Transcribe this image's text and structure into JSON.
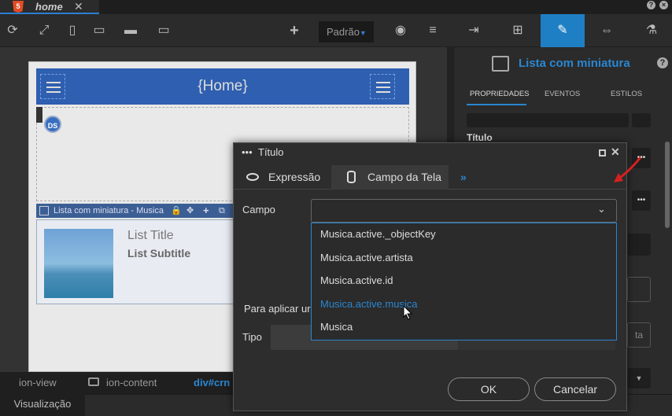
{
  "tabbar": {
    "title": "home",
    "html5": "5",
    "close": "✕",
    "icons": [
      "question-icon",
      "close-icon"
    ]
  },
  "toolbar": {
    "device_selector": "Padrão",
    "icons": [
      "refresh-icon",
      "expand-icon",
      "phone-icon",
      "tablet-icon",
      "desktop-icon",
      "monitor-icon",
      "add-icon",
      "eye-icon",
      "database-icon",
      "import-icon",
      "tree-icon",
      "pen-icon",
      "swap-icon",
      "flask-icon"
    ]
  },
  "canvas": {
    "header_title": "{Home}",
    "ds_logo": "DS",
    "list_bar_label": "Lista com miniatura - Musica",
    "list_title": "List Title",
    "list_subtitle": "List Subtitle"
  },
  "breadcrumb": {
    "items": [
      "ion-view",
      "ion-content",
      "div#crn"
    ]
  },
  "bottom": {
    "viz_label": "Visualização"
  },
  "right_panel": {
    "title": "Lista com miniatura",
    "tabs": [
      "PROPRIEDADES",
      "EVENTOS",
      "ESTILOS"
    ],
    "titulo_label": "Título",
    "more": "•••",
    "partial_text": "ta"
  },
  "dialog": {
    "title": "Título",
    "tabs": [
      "Expressão",
      "Campo da Tela"
    ],
    "tabs_more": "»",
    "campo_label": "Campo",
    "options": [
      "Musica.active._objectKey",
      "Musica.active.artista",
      "Musica.active.id",
      "Musica.active.musica",
      "Musica"
    ],
    "highlight_color": "#2a86d1",
    "aplicar_label": "Para aplicar ur",
    "tipo_label": "Tipo",
    "ok": "OK",
    "cancel": "Cancelar"
  }
}
